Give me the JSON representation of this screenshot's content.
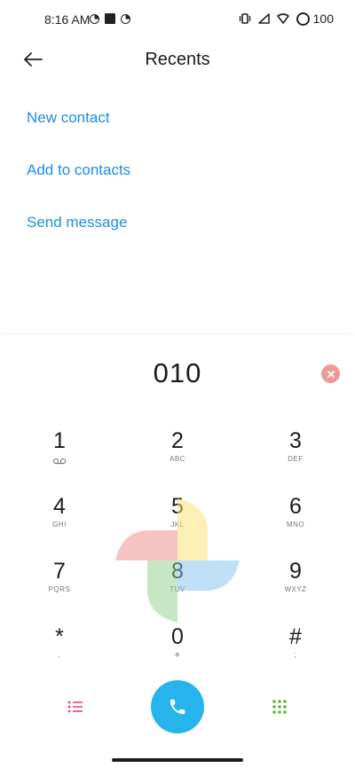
{
  "status_bar": {
    "time": "8:16 AM",
    "battery": "100"
  },
  "header": {
    "title": "Recents"
  },
  "actions": {
    "new_contact": "New contact",
    "add_to_contacts": "Add to contacts",
    "send_message": "Send message"
  },
  "dialer": {
    "number": "010",
    "keys": [
      {
        "digit": "1",
        "sub": ""
      },
      {
        "digit": "2",
        "sub": "ABC"
      },
      {
        "digit": "3",
        "sub": "DEF"
      },
      {
        "digit": "4",
        "sub": "GHI"
      },
      {
        "digit": "5",
        "sub": "JKL"
      },
      {
        "digit": "6",
        "sub": "MNO"
      },
      {
        "digit": "7",
        "sub": "PQRS"
      },
      {
        "digit": "8",
        "sub": "TUV"
      },
      {
        "digit": "9",
        "sub": "WXYZ"
      },
      {
        "digit": "*",
        "sub": ","
      },
      {
        "digit": "0",
        "sub": "+"
      },
      {
        "digit": "#",
        "sub": ";"
      }
    ]
  },
  "icons": {
    "back": "arrow-left-icon",
    "clear": "clear-icon",
    "voicemail": "voicemail-icon",
    "menu": "list-icon",
    "call": "phone-icon",
    "keypad": "keypad-icon",
    "watermark": "pinwheel-icon"
  },
  "colors": {
    "accent": "#1a8fe6",
    "call_button": "#27b3ec",
    "clear_button": "#ef9a9a",
    "menu_icon": "#e5486f",
    "keypad_icon": "#5cb82e"
  }
}
